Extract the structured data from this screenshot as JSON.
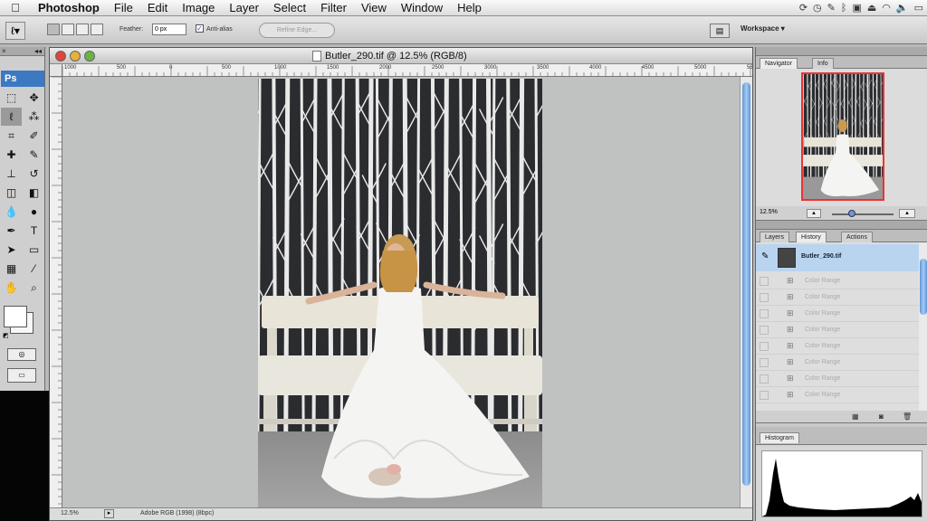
{
  "menubar": {
    "apple_icon": "apple-icon",
    "items": [
      {
        "label": "Photoshop",
        "bold": true
      },
      {
        "label": "File"
      },
      {
        "label": "Edit"
      },
      {
        "label": "Image"
      },
      {
        "label": "Layer"
      },
      {
        "label": "Select"
      },
      {
        "label": "Filter"
      },
      {
        "label": "View"
      },
      {
        "label": "Window"
      },
      {
        "label": "Help"
      }
    ]
  },
  "options": {
    "feather_label": "Feather:",
    "feather_value": "0 px",
    "antialias_label": "Anti-alias",
    "refine_label": "Refine Edge...",
    "workspace_label": "Workspace ▾"
  },
  "toolpanel": {
    "logo": "Ps",
    "close_glyph": "×",
    "collapse_glyph": "◂◂"
  },
  "document": {
    "title": "Butler_290.tif @ 12.5% (RGB/8)",
    "ruler_labels": [
      "1000",
      "500",
      "0",
      "500",
      "1000",
      "1500",
      "2000",
      "2500",
      "3000",
      "3500",
      "4000",
      "4500",
      "5000",
      "5500",
      "6000"
    ],
    "zoom_readout": "12.5%",
    "profile_readout": "Adobe RGB (1998) (8bpc)"
  },
  "navigator": {
    "tabs": [
      "Navigator",
      "Info"
    ],
    "zoom_value": "12.5%"
  },
  "history": {
    "tabs": [
      "Layers",
      "History",
      "Actions"
    ],
    "snapshot_name": "Butler_290.tif",
    "states": [
      "Color Range",
      "Color Range",
      "Color Range",
      "Color Range",
      "Color Range",
      "Color Range",
      "Color Range",
      "Color Range"
    ]
  },
  "histogram": {
    "tab": "Histogram"
  }
}
